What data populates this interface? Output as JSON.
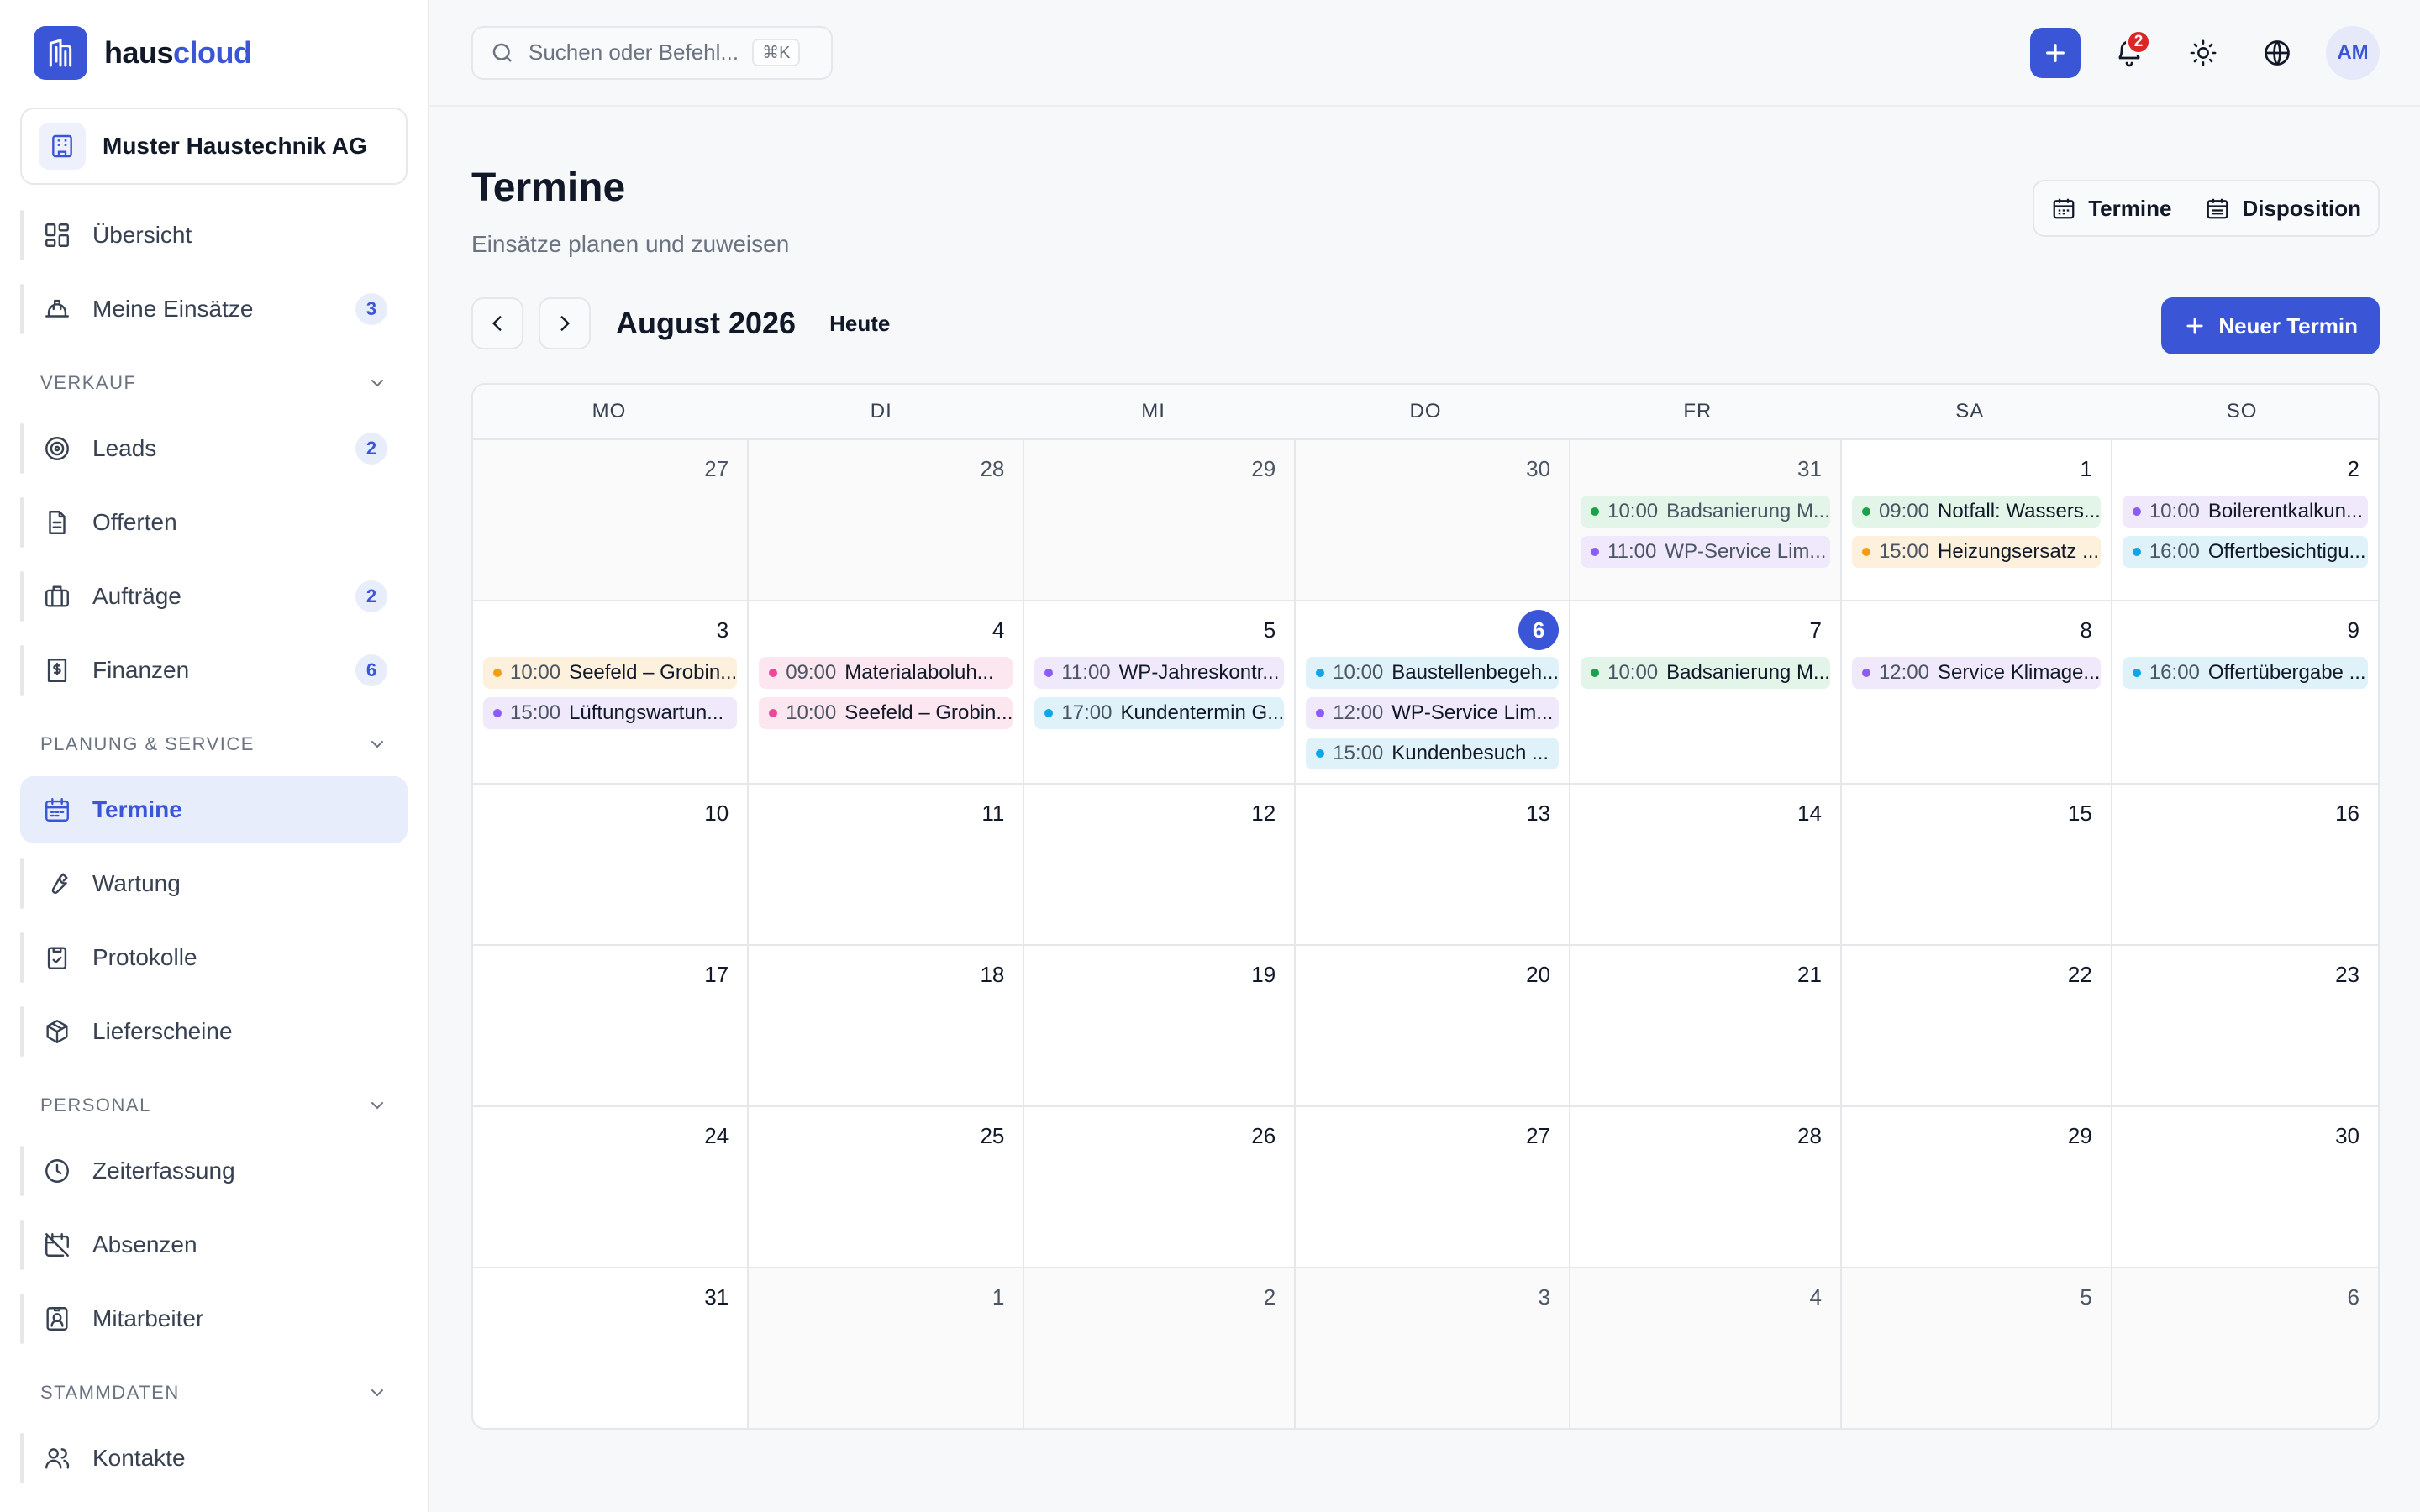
{
  "brand": {
    "name_a": "haus",
    "name_b": "cloud"
  },
  "company": {
    "name": "Muster Haustechnik AG"
  },
  "sidebar": {
    "top_items": [
      {
        "label": "Übersicht",
        "icon": "dashboard-icon",
        "badge": ""
      },
      {
        "label": "Meine Einsätze",
        "icon": "hard-hat-icon",
        "badge": "3"
      }
    ],
    "sections": [
      {
        "title": "Verkauf",
        "items": [
          {
            "label": "Leads",
            "icon": "target-icon",
            "badge": "2"
          },
          {
            "label": "Offerten",
            "icon": "document-icon",
            "badge": ""
          },
          {
            "label": "Aufträge",
            "icon": "briefcase-icon",
            "badge": "2"
          },
          {
            "label": "Finanzen",
            "icon": "receipt-icon",
            "badge": "6"
          }
        ]
      },
      {
        "title": "Planung & Service",
        "items": [
          {
            "label": "Termine",
            "icon": "calendar-icon",
            "badge": "",
            "active": true
          },
          {
            "label": "Wartung",
            "icon": "wrench-icon",
            "badge": ""
          },
          {
            "label": "Protokolle",
            "icon": "clipboard-icon",
            "badge": ""
          },
          {
            "label": "Lieferscheine",
            "icon": "package-icon",
            "badge": ""
          }
        ]
      },
      {
        "title": "Personal",
        "items": [
          {
            "label": "Zeiterfassung",
            "icon": "clock-icon",
            "badge": ""
          },
          {
            "label": "Absenzen",
            "icon": "calendar-off-icon",
            "badge": ""
          },
          {
            "label": "Mitarbeiter",
            "icon": "id-badge-icon",
            "badge": ""
          }
        ]
      },
      {
        "title": "Stammdaten",
        "items": [
          {
            "label": "Kontakte",
            "icon": "users-icon",
            "badge": ""
          }
        ]
      }
    ]
  },
  "topbar": {
    "search_placeholder": "Suchen oder Befehl...",
    "shortcut": "⌘K",
    "notification_count": "2",
    "avatar_initials": "AM"
  },
  "page": {
    "title": "Termine",
    "subtitle": "Einsätze planen und zuweisen",
    "view_termine": "Termine",
    "view_disposition": "Disposition",
    "month": "August 2026",
    "today": "Heute",
    "new_button": "Neuer Termin"
  },
  "colors": {
    "accent": "#3a56d6",
    "green": "#16a34a",
    "green_bg": "#e3f4e8",
    "purple": "#8b5cf6",
    "purple_bg": "#efe9fb",
    "orange": "#f59e0b",
    "orange_bg": "#fdf0dc",
    "cyan": "#0ea5e9",
    "cyan_bg": "#dff2fa",
    "pink": "#ec4899",
    "pink_bg": "#fce7f0"
  },
  "calendar": {
    "weekdays": [
      "MO",
      "DI",
      "MI",
      "DO",
      "FR",
      "SA",
      "SO"
    ],
    "days": [
      {
        "n": "27",
        "dim": true,
        "events": []
      },
      {
        "n": "28",
        "dim": true,
        "events": []
      },
      {
        "n": "29",
        "dim": true,
        "events": []
      },
      {
        "n": "30",
        "dim": true,
        "events": []
      },
      {
        "n": "31",
        "dim": true,
        "events": [
          {
            "time": "10:00",
            "title": "Badsanierung M...",
            "color": "green",
            "past": true
          },
          {
            "time": "11:00",
            "title": "WP-Service Lim...",
            "color": "purple",
            "past": true
          }
        ]
      },
      {
        "n": "1",
        "events": [
          {
            "time": "09:00",
            "title": "Notfall: Wassers...",
            "color": "green"
          },
          {
            "time": "15:00",
            "title": "Heizungsersatz ...",
            "color": "orange"
          }
        ]
      },
      {
        "n": "2",
        "events": [
          {
            "time": "10:00",
            "title": "Boilerentkalkun...",
            "color": "purple"
          },
          {
            "time": "16:00",
            "title": "Offertbesichtigu...",
            "color": "cyan"
          }
        ]
      },
      {
        "n": "3",
        "events": [
          {
            "time": "10:00",
            "title": "Seefeld – Grobin...",
            "color": "orange"
          },
          {
            "time": "15:00",
            "title": "Lüftungswartun...",
            "color": "purple"
          }
        ]
      },
      {
        "n": "4",
        "events": [
          {
            "time": "09:00",
            "title": "Materialaboluh...",
            "color": "pink"
          },
          {
            "time": "10:00",
            "title": "Seefeld – Grobin...",
            "color": "pink"
          }
        ]
      },
      {
        "n": "5",
        "events": [
          {
            "time": "11:00",
            "title": "WP-Jahreskontr...",
            "color": "purple"
          },
          {
            "time": "17:00",
            "title": "Kundentermin G...",
            "color": "cyan"
          }
        ]
      },
      {
        "n": "6",
        "today": true,
        "events": [
          {
            "time": "10:00",
            "title": "Baustellenbegeh...",
            "color": "cyan"
          },
          {
            "time": "12:00",
            "title": "WP-Service Lim...",
            "color": "purple"
          },
          {
            "time": "15:00",
            "title": "Kundenbesuch ...",
            "color": "cyan"
          }
        ]
      },
      {
        "n": "7",
        "events": [
          {
            "time": "10:00",
            "title": "Badsanierung M...",
            "color": "green"
          }
        ]
      },
      {
        "n": "8",
        "events": [
          {
            "time": "12:00",
            "title": "Service Klimage...",
            "color": "purple"
          }
        ]
      },
      {
        "n": "9",
        "events": [
          {
            "time": "16:00",
            "title": "Offertübergabe ...",
            "color": "cyan"
          }
        ]
      },
      {
        "n": "10",
        "events": []
      },
      {
        "n": "11",
        "events": []
      },
      {
        "n": "12",
        "events": []
      },
      {
        "n": "13",
        "events": []
      },
      {
        "n": "14",
        "events": []
      },
      {
        "n": "15",
        "events": []
      },
      {
        "n": "16",
        "events": []
      },
      {
        "n": "17",
        "events": []
      },
      {
        "n": "18",
        "events": []
      },
      {
        "n": "19",
        "events": []
      },
      {
        "n": "20",
        "events": []
      },
      {
        "n": "21",
        "events": []
      },
      {
        "n": "22",
        "events": []
      },
      {
        "n": "23",
        "events": []
      },
      {
        "n": "24",
        "events": []
      },
      {
        "n": "25",
        "events": []
      },
      {
        "n": "26",
        "events": []
      },
      {
        "n": "27",
        "events": []
      },
      {
        "n": "28",
        "events": []
      },
      {
        "n": "29",
        "events": []
      },
      {
        "n": "30",
        "events": []
      },
      {
        "n": "31",
        "events": []
      },
      {
        "n": "1",
        "dim": true,
        "events": []
      },
      {
        "n": "2",
        "dim": true,
        "events": []
      },
      {
        "n": "3",
        "dim": true,
        "events": []
      },
      {
        "n": "4",
        "dim": true,
        "events": []
      },
      {
        "n": "5",
        "dim": true,
        "events": []
      },
      {
        "n": "6",
        "dim": true,
        "events": []
      }
    ]
  }
}
